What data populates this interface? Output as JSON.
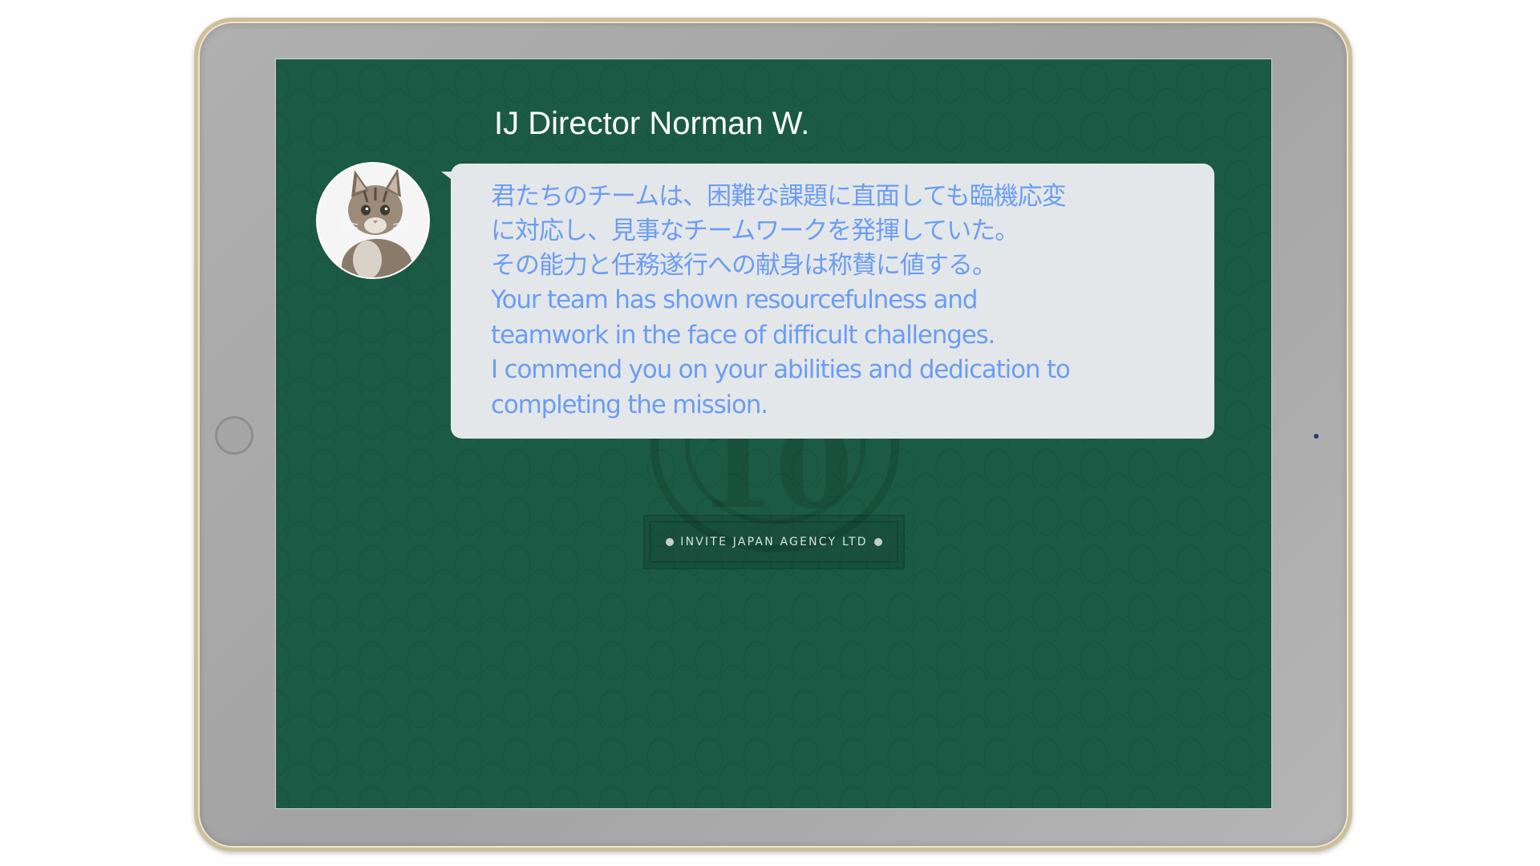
{
  "dialogue": {
    "speaker_name": "IJ Director Norman W.",
    "message_jp": "君たちのチームは、困難な課題に直面しても臨機応変\nに対応し、見事なチームワークを発揮していた。\nその能力と任務遂行への献身は称賛に値する。",
    "message_en": "Your team has shown resourcefulness and\nteamwork in the face of difficult challenges.\nI commend you on your abilities and dedication to\ncompleting the mission.",
    "avatar_icon": "kitten-avatar"
  },
  "background": {
    "emblem_number": "10",
    "agency_plaque": "INVITE JAPAN AGENCY LTD"
  },
  "colors": {
    "screen_bg": "#1b5a44",
    "bubble_bg": "#e4e7ea",
    "message_text": "#6b9df2",
    "speaker_text": "#ffffff"
  }
}
